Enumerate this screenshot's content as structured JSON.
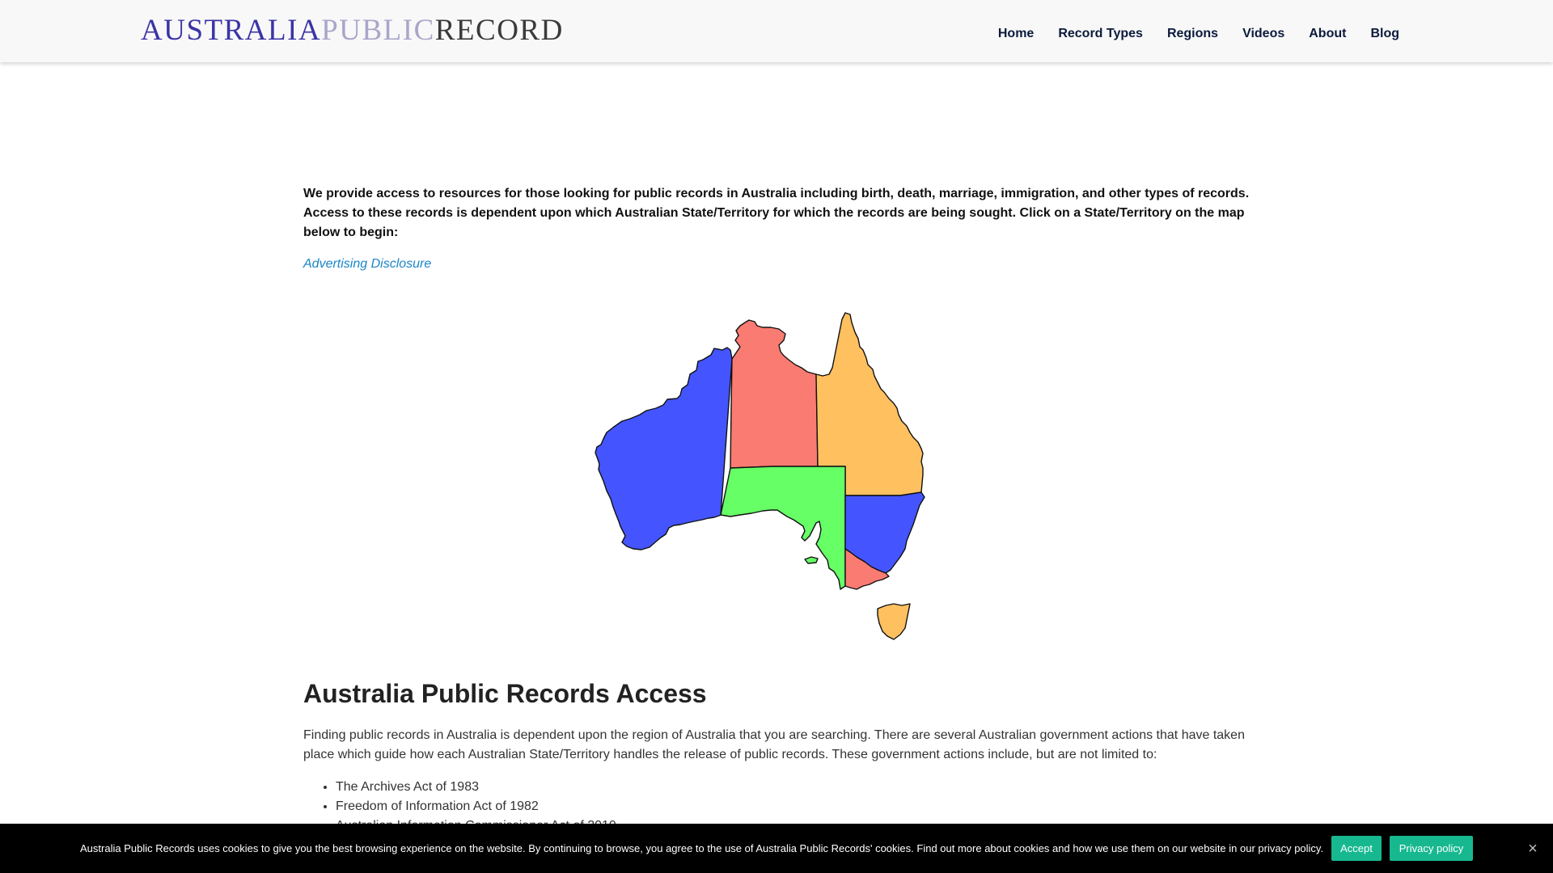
{
  "header": {
    "logo": {
      "part1": "AUSTRALIA",
      "part2": "PUBLIC",
      "part3": "RECORD"
    },
    "nav": [
      "Home",
      "Record Types",
      "Regions",
      "Videos",
      "About",
      "Blog"
    ]
  },
  "intro": {
    "text": "We provide access to resources for those looking for public records in Australia including birth, death, marriage, immigration, and other types of records. Access to these records is dependent upon which Australian State/Territory for which the records are being sought. Click on a State/Territory on the map below to begin:",
    "disclosure_link": "Advertising Disclosure"
  },
  "map": {
    "regions": [
      {
        "name": "Western Australia",
        "color": "#4455ff"
      },
      {
        "name": "Northern Territory",
        "color": "#fa7b72"
      },
      {
        "name": "Queensland",
        "color": "#ffc060"
      },
      {
        "name": "South Australia",
        "color": "#66ff66"
      },
      {
        "name": "New South Wales",
        "color": "#4455ff"
      },
      {
        "name": "Victoria",
        "color": "#fa7b72"
      },
      {
        "name": "Tasmania",
        "color": "#ffc060"
      }
    ]
  },
  "section": {
    "title": "Australia Public Records Access",
    "body": "Finding public records in Australia is dependent upon the region of Australia that you are searching. There are several Australian government actions that have taken place which guide how each Australian State/Territory handles the release of public records. These government actions include, but are not limited to:",
    "list": [
      "The Archives Act of 1983",
      "Freedom of Information Act of 1982",
      "Australian Information Commissioner Act of 2010"
    ]
  },
  "cookie": {
    "text": "Australia Public Records uses cookies to give you the best browsing experience on the website. By continuing to browse, you agree to the use of Australia Public Records' cookies. Find out more about cookies and how we use them on our website in our privacy policy.",
    "accept": "Accept",
    "privacy": "Privacy policy",
    "close": "×"
  }
}
